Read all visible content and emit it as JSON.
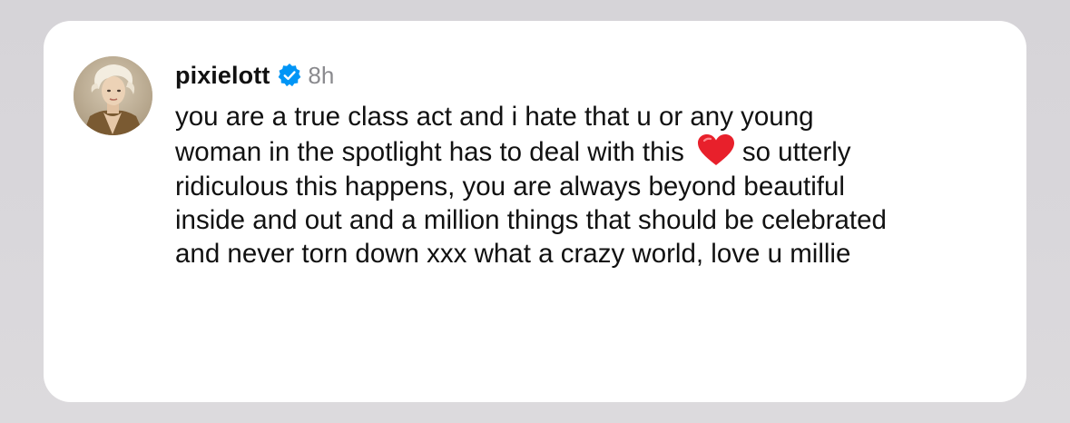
{
  "comment": {
    "username": "pixielott",
    "verified_icon": "verified-badge-icon",
    "timestamp": "8h",
    "text_before_emoji": "you are a true class act and i hate that u or any young woman in the spotlight has to deal with this",
    "emoji": "heart-emoji",
    "text_after_emoji": "so utterly ridiculous this happens, you are always beyond beautiful inside and out and a million things that should be celebrated and never torn down xxx what a crazy world, love u millie"
  },
  "colors": {
    "background": "#d9d7db",
    "card": "#ffffff",
    "text": "#111111",
    "timestamp": "#8a8a8e",
    "verified": "#0095f6",
    "heart": "#e8202b"
  }
}
